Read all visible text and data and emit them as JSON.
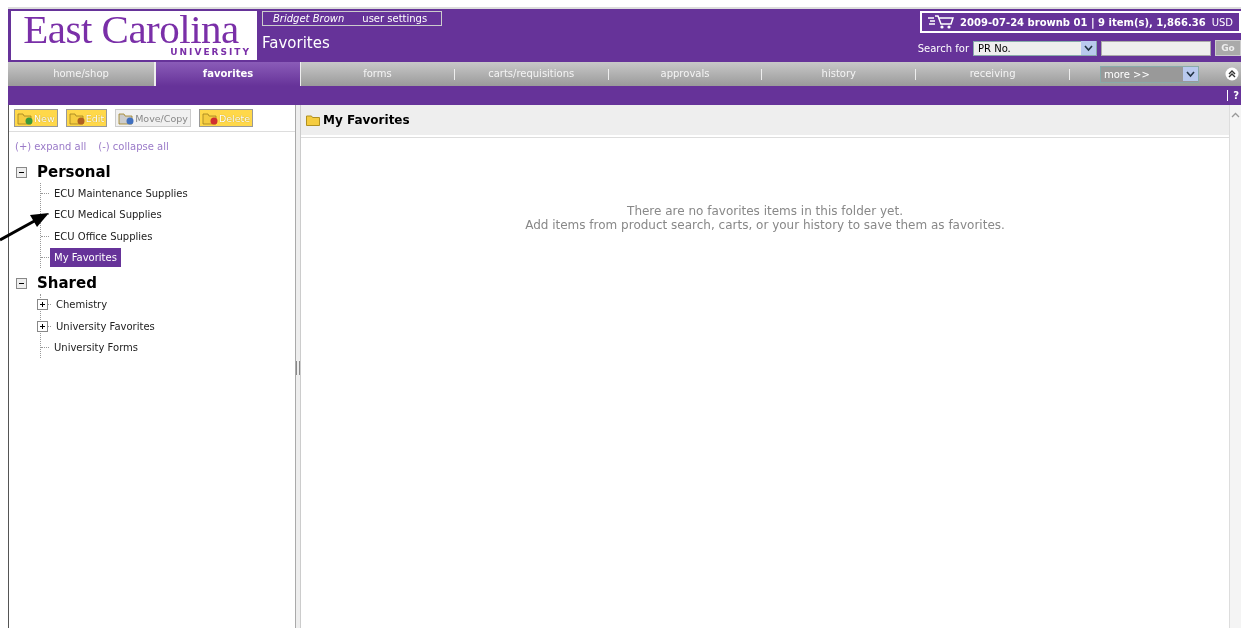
{
  "logo": {
    "name": "East Carolina",
    "subtitle": "UNIVERSITY"
  },
  "user": {
    "name": "Bridget Brown",
    "settings_link": "user settings"
  },
  "page_title": "Favorites",
  "cart": {
    "label": "2009-07-24 brownb 01 | 9 item(s), 1,866.36",
    "currency": "USD"
  },
  "search": {
    "label": "Search for",
    "scope": "PR No.",
    "button": "Go"
  },
  "tabs": [
    {
      "label": "home/shop",
      "selected": false
    },
    {
      "label": "favorites",
      "selected": true
    },
    {
      "label": "forms",
      "selected": false
    },
    {
      "label": "carts/requisitions",
      "selected": false
    },
    {
      "label": "approvals",
      "selected": false
    },
    {
      "label": "history",
      "selected": false
    },
    {
      "label": "receiving",
      "selected": false
    }
  ],
  "more_select": "more >>",
  "help": "?",
  "toolbar": [
    {
      "label": "New",
      "kind": "new",
      "disabled": false
    },
    {
      "label": "Edit",
      "kind": "edit",
      "disabled": false
    },
    {
      "label": "Move/Copy",
      "kind": "move",
      "disabled": true
    },
    {
      "label": "Delete",
      "kind": "delete",
      "disabled": false
    }
  ],
  "tree_links": [
    "(+) expand all",
    "(-) collapse all"
  ],
  "tree": [
    {
      "label": "Personal",
      "expanded": true,
      "children": [
        {
          "label": "ECU Maintenance Supplies",
          "kind": "leaf",
          "selected": false
        },
        {
          "label": "ECU Medical Supplies",
          "kind": "leaf",
          "selected": false
        },
        {
          "label": "ECU Office Supplies",
          "kind": "leaf",
          "selected": false
        },
        {
          "label": "My Favorites",
          "kind": "leaf",
          "selected": true
        }
      ]
    },
    {
      "label": "Shared",
      "expanded": true,
      "children": [
        {
          "label": "Chemistry",
          "kind": "group",
          "expanded": false,
          "selected": false
        },
        {
          "label": "University Favorites",
          "kind": "group",
          "expanded": false,
          "selected": false
        },
        {
          "label": "University Forms",
          "kind": "leaf",
          "selected": false
        }
      ]
    }
  ],
  "folder": {
    "title": "My Favorites",
    "empty_message": [
      "There are no favorites items in this folder yet.",
      "Add items from product search, carts, or your history to save them as favorites."
    ]
  }
}
